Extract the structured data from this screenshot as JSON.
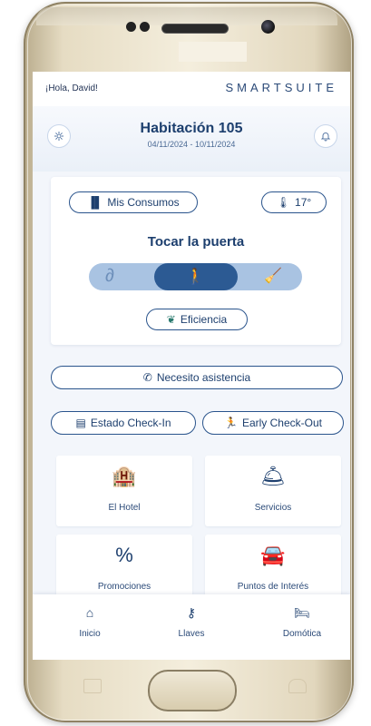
{
  "header": {
    "greeting": "¡Hola, David!",
    "brand": "SMARTSUITE",
    "room_title": "Habitación 105",
    "dates": "04/11/2024 - 10/11/2024",
    "settings_icon": "gear-icon",
    "notifications_icon": "bell-icon"
  },
  "panel": {
    "consumption_label": "Mis Consumos",
    "temperature_label": "17°",
    "knock_label": "Tocar la puerta",
    "efficiency_label": "Eficiencia",
    "segment_options": [
      "do-not-disturb",
      "knock",
      "clean-room"
    ]
  },
  "actions": {
    "assistance_label": "Necesito asistencia",
    "checkin_label": "Estado Check-In",
    "checkout_label": "Early Check-Out"
  },
  "grid": [
    {
      "label": "El Hotel",
      "icon": "building-icon"
    },
    {
      "label": "Servicios",
      "icon": "service-bell-icon"
    },
    {
      "label": "Promociones",
      "icon": "percent-icon"
    },
    {
      "label": "Puntos de Interés",
      "icon": "car-icon"
    }
  ],
  "tabs": [
    {
      "label": "Inicio",
      "icon": "home-icon"
    },
    {
      "label": "Llaves",
      "icon": "key-icon"
    },
    {
      "label": "Domótica",
      "icon": "bed-icon"
    }
  ],
  "colors": {
    "primary": "#1d3f6e",
    "accent_segment": "#2c5a93",
    "segment_bg": "#a9c3e2",
    "screen_bg": "#f3f6fb"
  }
}
